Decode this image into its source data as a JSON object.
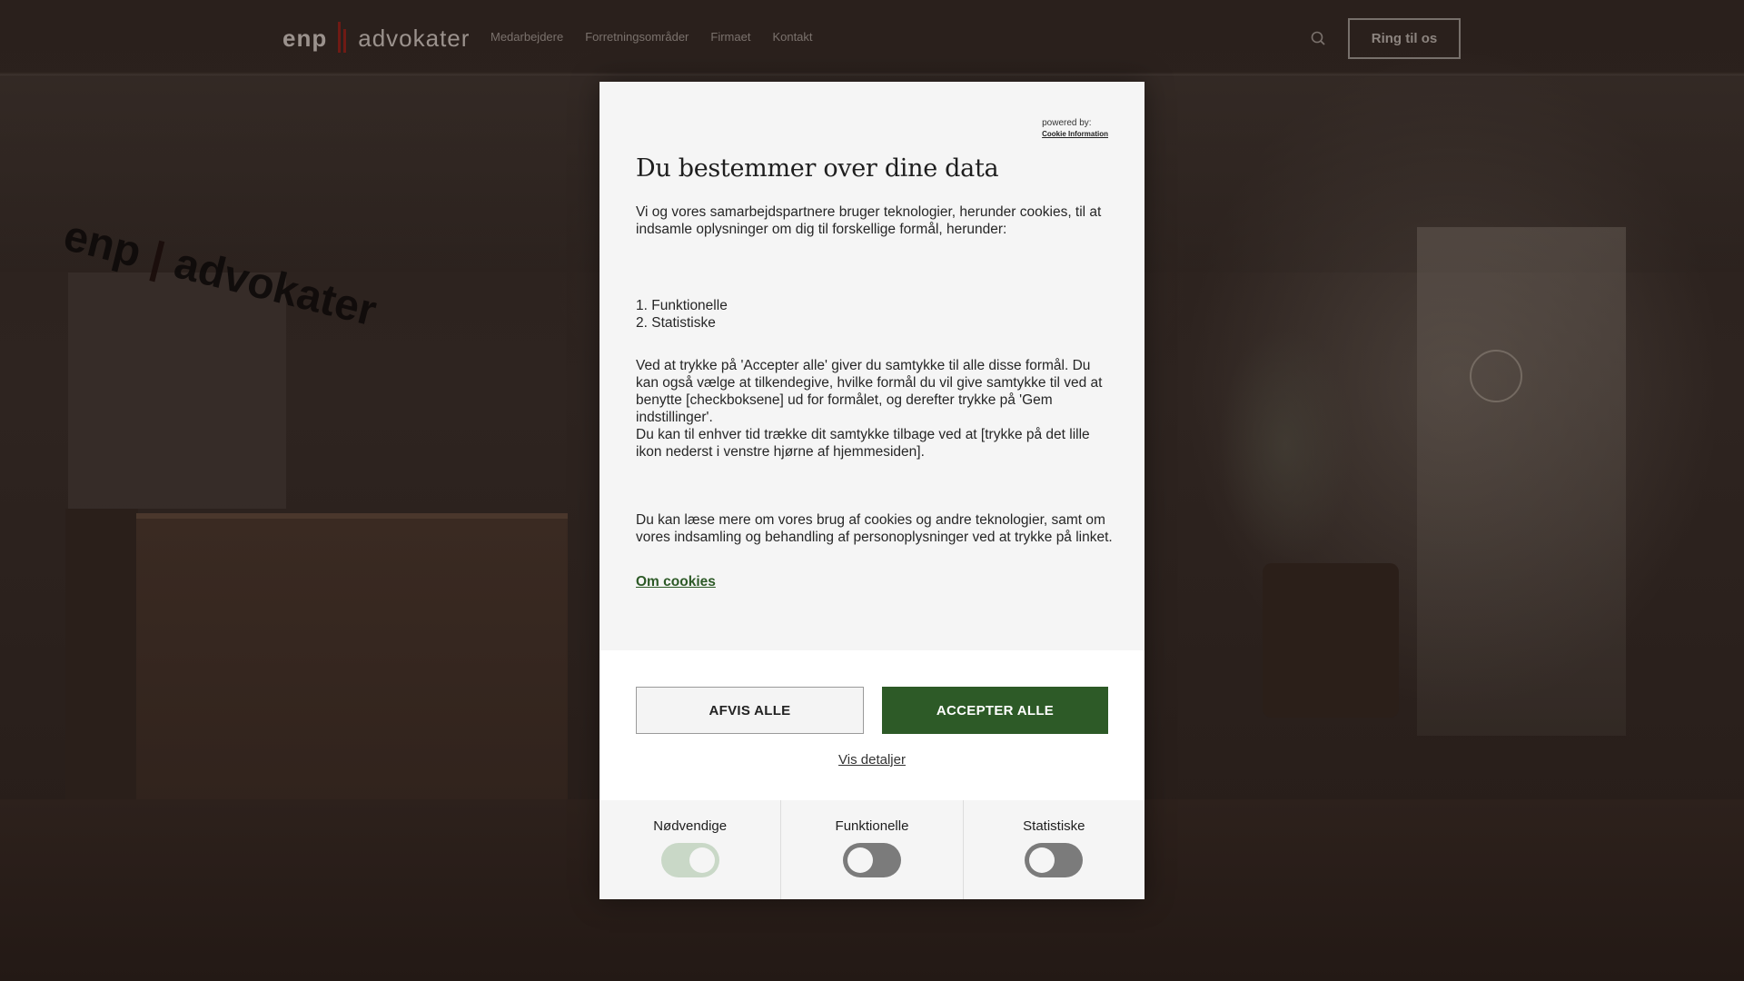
{
  "header": {
    "logo_left": "enp",
    "logo_right": "advokater",
    "nav": [
      "Medarbejdere",
      "Forretningsområder",
      "Firmaet",
      "Kontakt"
    ],
    "search_icon": "search-icon",
    "call_button": "Ring til os"
  },
  "background": {
    "wall_logo_left": "enp",
    "wall_logo_right": "advokater"
  },
  "modal": {
    "powered_by": "powered by:",
    "powered_link": "Cookie Information",
    "title": "Du bestemmer over dine data",
    "intro": "Vi og vores samarbejdspartnere bruger teknologier, herunder cookies, til at indsamle oplysninger om dig til forskellige formål, herunder:",
    "purposes": [
      "1. Funktionelle",
      "2. Statistiske"
    ],
    "consent_text_1": "Ved at trykke på 'Accepter alle' giver du samtykke til alle disse formål. Du kan også vælge at tilkendegive, hvilke formål du vil give samtykke til ved at benytte [checkboksene] ud for formålet, og derefter trykke på 'Gem indstillinger'.",
    "consent_text_2": "Du kan til enhver tid trække dit samtykke tilbage ved at [trykke på det lille ikon nederst i venstre hjørne af hjemmesiden].",
    "more_text": "Du kan læse mere om vores brug af cookies og andre teknologier, samt om vores indsamling og behandling af personoplysninger ved at trykke på linket.",
    "about_link": "Om cookies",
    "reject_button": "AFVIS ALLE",
    "accept_button": "ACCEPTER ALLE",
    "details_link": "Vis detaljer",
    "toggles": [
      {
        "label": "Nødvendige",
        "on": true
      },
      {
        "label": "Funktionelle",
        "on": false
      },
      {
        "label": "Statistiske",
        "on": false
      }
    ],
    "accent_color": "#2d5a27"
  }
}
